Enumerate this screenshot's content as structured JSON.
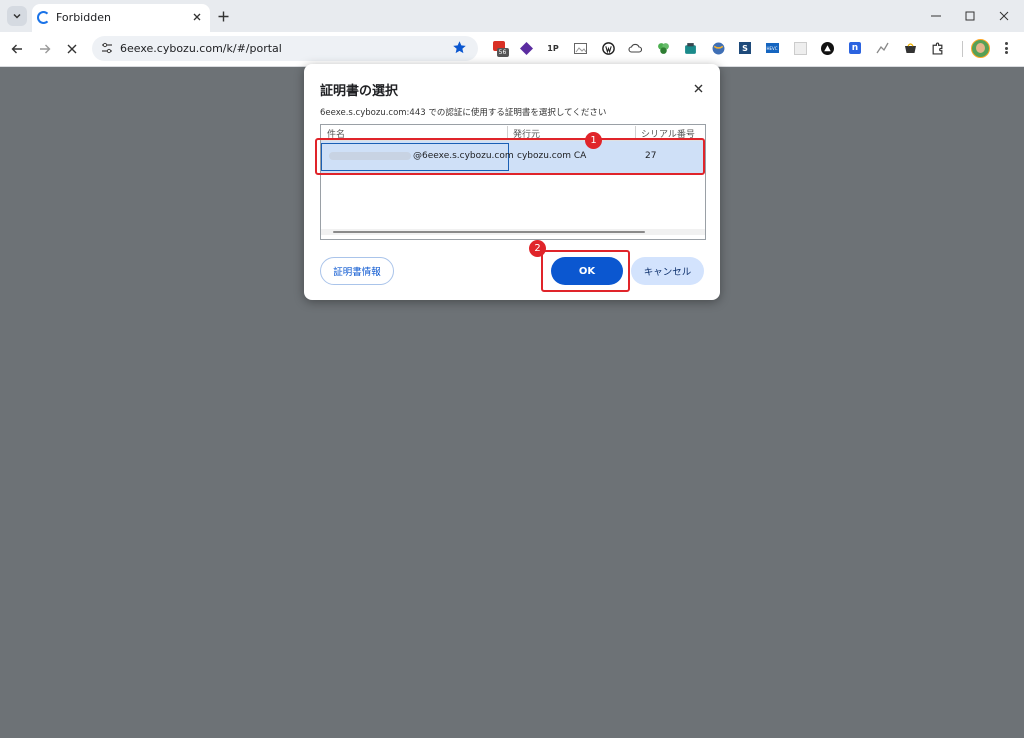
{
  "browser": {
    "tab_title": "Forbidden",
    "url": "6eexe.cybozu.com/k/#/portal",
    "extension_badge": "56",
    "extensions": [
      "gmail-ext-icon",
      "purple-diamond-icon",
      "1p-icon",
      "image-ext-icon",
      "wordpress-icon",
      "cloud-icon",
      "leaf-icon",
      "android-icon",
      "globe-icon",
      "s-square-icon",
      "hevc-icon",
      "blank-ext-icon",
      "triangle-circle-icon",
      "n-square-icon",
      "line-chart-icon",
      "shopping-icon",
      "puzzle-icon"
    ]
  },
  "dialog": {
    "title": "証明書の選択",
    "description": "6eexe.s.cybozu.com:443 での認証に使用する証明書を選択してください",
    "columns": [
      "件名",
      "発行元",
      "シリアル番号"
    ],
    "rows": [
      {
        "subject": "@6eexe.s.cybozu.com",
        "issuer": "cybozu.com CA",
        "serial": "27"
      }
    ],
    "info_button": "証明書情報",
    "ok_button": "OK",
    "cancel_button": "キャンセル"
  },
  "annotations": {
    "badge1": "1",
    "badge2": "2"
  },
  "colors": {
    "accent": "#0b57d0",
    "selection": "#cfe0f7",
    "highlight": "#e0242a",
    "backdrop": "#6d7276"
  }
}
